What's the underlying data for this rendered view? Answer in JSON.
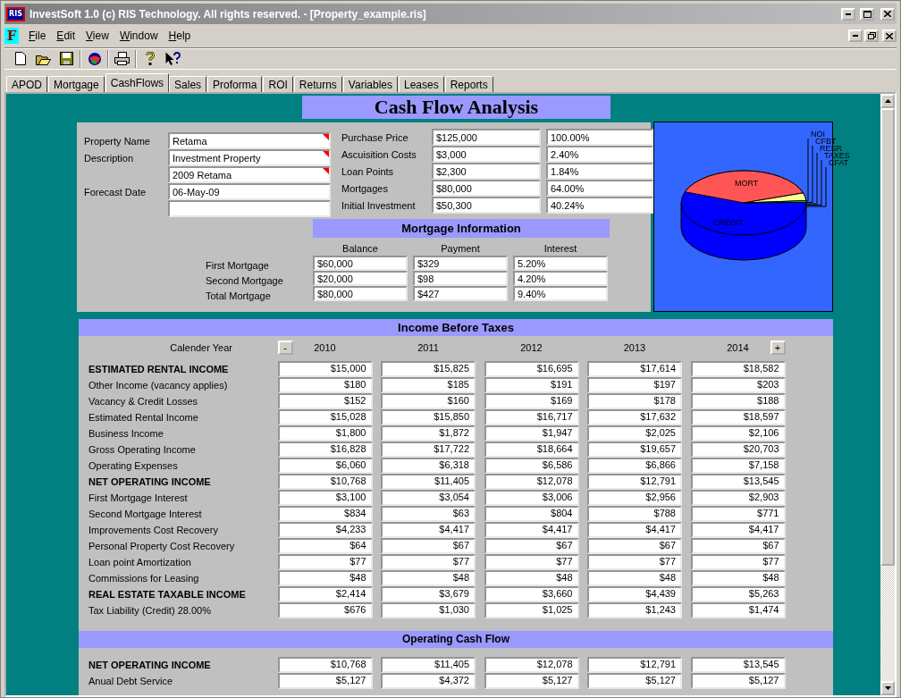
{
  "window": {
    "icon_text": "RIS",
    "title": "InvestSoft 1.0 (c) RIS Technology. All rights reserved. - [Property_example.ris]"
  },
  "menu_icon_text": "F",
  "menu": [
    {
      "label": "File"
    },
    {
      "label": "Edit"
    },
    {
      "label": "View"
    },
    {
      "label": "Window"
    },
    {
      "label": "Help"
    }
  ],
  "tabs": [
    {
      "label": "APOD",
      "selected": false
    },
    {
      "label": "Mortgage",
      "selected": false
    },
    {
      "label": "CashFlows",
      "selected": true
    },
    {
      "label": "Sales",
      "selected": false
    },
    {
      "label": "Proforma",
      "selected": false
    },
    {
      "label": "ROI",
      "selected": false
    },
    {
      "label": "Returns",
      "selected": false
    },
    {
      "label": "Variables",
      "selected": false
    },
    {
      "label": "Leases",
      "selected": false
    },
    {
      "label": "Reports",
      "selected": false
    }
  ],
  "page_title": "Cash Flow Analysis",
  "property": {
    "fields": [
      {
        "label": "Property Name",
        "value": "Retama",
        "flagged": true
      },
      {
        "label": "Description",
        "value": "Investment Property",
        "flagged": true
      },
      {
        "value": "2009 Retama",
        "flagged": true
      },
      {
        "label": "Forecast Date",
        "value": "06-May-09",
        "flagged": false
      },
      {
        "flagged": false
      }
    ]
  },
  "costs": [
    {
      "label": "Purchase Price",
      "amount": "$125,000",
      "percent": "100.00%"
    },
    {
      "label": "Ascuisition Costs",
      "amount": "$3,000",
      "percent": "2.40%"
    },
    {
      "label": "Loan Points",
      "amount": "$2,300",
      "percent": "1.84%"
    },
    {
      "label": "Mortgages",
      "amount": "$80,000",
      "percent": "64.00%"
    },
    {
      "label": "Initial Investment",
      "amount": "$50,300",
      "percent": "40.24%"
    }
  ],
  "mortgage": {
    "title": "Mortgage Information",
    "columns": [
      "Balance",
      "Payment",
      "Interest"
    ],
    "rows": [
      {
        "label": "First Mortgage",
        "values": [
          "$60,000",
          "$329",
          "5.20%"
        ]
      },
      {
        "label": "Second Mortgage",
        "values": [
          "$20,000",
          "$98",
          "4.20%"
        ]
      },
      {
        "label": "Total Mortgage",
        "values": [
          "$80,000",
          "$427",
          "9.40%"
        ]
      }
    ]
  },
  "chart": {
    "slice_labels": [
      "MORT",
      "CREDIT"
    ],
    "legend_labels": [
      "NOI",
      "CFBT",
      "RESR",
      "TAXES",
      "CFAT"
    ]
  },
  "income": {
    "title": "Income Before Taxes",
    "year_label": "Calender Year",
    "prev_button": "-",
    "next_button": "+",
    "years": [
      "2010",
      "2011",
      "2012",
      "2013",
      "2014"
    ],
    "rows": [
      {
        "label": "ESTIMATED RENTAL INCOME",
        "emphasis": true,
        "values": [
          "$15,000",
          "$15,825",
          "$16,695",
          "$17,614",
          "$18,582"
        ]
      },
      {
        "label": "Other Income (vacancy applies)",
        "emphasis": false,
        "values": [
          "$180",
          "$185",
          "$191",
          "$197",
          "$203"
        ]
      },
      {
        "label": "Vacancy & Credit Losses",
        "emphasis": false,
        "values": [
          "$152",
          "$160",
          "$169",
          "$178",
          "$188"
        ]
      },
      {
        "label": "Estimated Rental Income",
        "emphasis": false,
        "values": [
          "$15,028",
          "$15,850",
          "$16,717",
          "$17,632",
          "$18,597"
        ]
      },
      {
        "label": "Business Income",
        "emphasis": false,
        "values": [
          "$1,800",
          "$1,872",
          "$1,947",
          "$2,025",
          "$2,106"
        ]
      },
      {
        "label": "Gross Operating Income",
        "emphasis": false,
        "values": [
          "$16,828",
          "$17,722",
          "$18,664",
          "$19,657",
          "$20,703"
        ]
      },
      {
        "label": "Operating Expenses",
        "emphasis": false,
        "values": [
          "$6,060",
          "$6,318",
          "$6,586",
          "$6,866",
          "$7,158"
        ]
      },
      {
        "label": "NET OPERATING INCOME",
        "emphasis": true,
        "values": [
          "$10,768",
          "$11,405",
          "$12,078",
          "$12,791",
          "$13,545"
        ]
      },
      {
        "label": "First Mortgage Interest",
        "emphasis": false,
        "values": [
          "$3,100",
          "$3,054",
          "$3,006",
          "$2,956",
          "$2,903"
        ]
      },
      {
        "label": "Second Mortgage Interest",
        "emphasis": false,
        "values": [
          "$834",
          "$63",
          "$804",
          "$788",
          "$771"
        ]
      },
      {
        "label": "Improvements Cost Recovery",
        "emphasis": false,
        "values": [
          "$4,233",
          "$4,417",
          "$4,417",
          "$4,417",
          "$4,417"
        ]
      },
      {
        "label": "Personal Property Cost Recovery",
        "emphasis": false,
        "values": [
          "$64",
          "$67",
          "$67",
          "$67",
          "$67"
        ]
      },
      {
        "label": "Loan point Amortization",
        "emphasis": false,
        "values": [
          "$77",
          "$77",
          "$77",
          "$77",
          "$77"
        ]
      },
      {
        "label": "Commissions for Leasing",
        "emphasis": false,
        "values": [
          "$48",
          "$48",
          "$48",
          "$48",
          "$48"
        ]
      },
      {
        "label": "REAL ESTATE TAXABLE INCOME",
        "emphasis": true,
        "values": [
          "$2,414",
          "$3,679",
          "$3,660",
          "$4,439",
          "$5,263"
        ]
      },
      {
        "label": "Tax Liability (Credit) 28.00%",
        "emphasis": false,
        "values": [
          "$676",
          "$1,030",
          "$1,025",
          "$1,243",
          "$1,474"
        ]
      }
    ]
  },
  "operating": {
    "title": "Operating Cash Flow",
    "rows": [
      {
        "label": "NET OPERATING INCOME",
        "emphasis": true,
        "values": [
          "$10,768",
          "$11,405",
          "$12,078",
          "$12,791",
          "$13,545"
        ]
      },
      {
        "label": "Anual Debt Service",
        "emphasis": false,
        "values": [
          "$5,127",
          "$4,372",
          "$5,127",
          "$5,127",
          "$5,127"
        ]
      }
    ]
  }
}
